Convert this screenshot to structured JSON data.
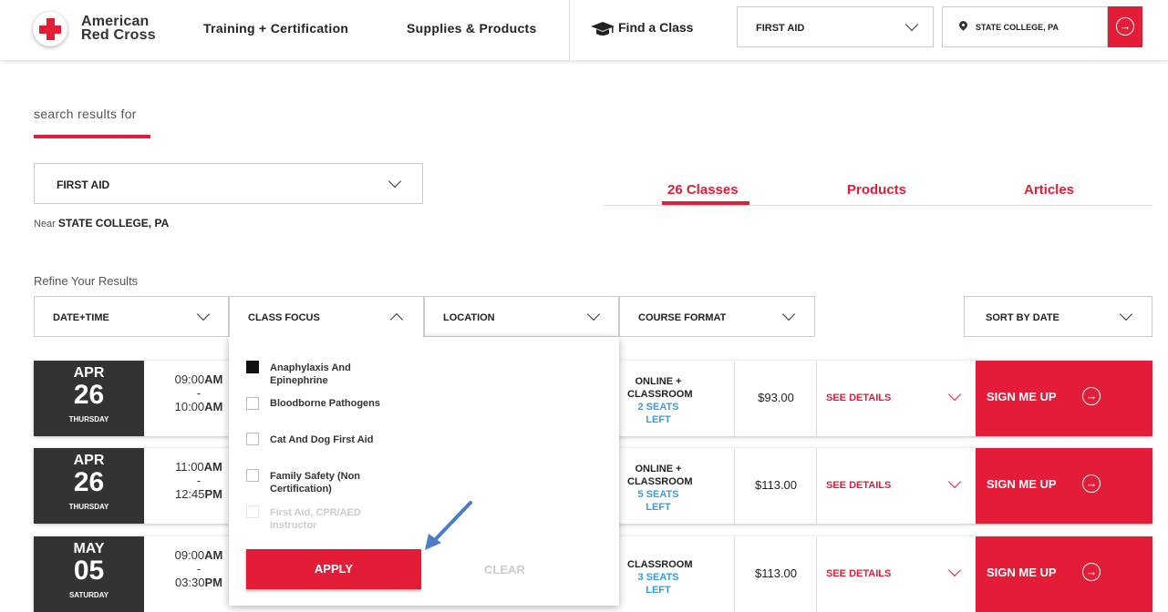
{
  "header": {
    "logo_line1": "American",
    "logo_line2": "Red Cross",
    "nav": [
      "Training + Certification",
      "Supplies & Products"
    ],
    "find_label": "Find a Class",
    "course_select": "FIRST AID",
    "location": "STATE COLLEGE, PA",
    "go_icon": "arrow-right-circle-icon"
  },
  "search": {
    "label": "search results for",
    "course_select": "FIRST AID",
    "near_label": "Near",
    "near_value": "STATE COLLEGE, PA"
  },
  "tabs": [
    "26 Classes",
    "Products",
    "Articles"
  ],
  "refine": {
    "title": "Refine Your Results",
    "filters": [
      "DATE+TIME",
      "CLASS FOCUS",
      "LOCATION",
      "COURSE FORMAT"
    ],
    "sort": "SORT BY DATE"
  },
  "class_focus": {
    "options": [
      {
        "label": "Anaphylaxis And Epinephrine",
        "checked": true,
        "disabled": false
      },
      {
        "label": "Bloodborne Pathogens",
        "checked": false,
        "disabled": false
      },
      {
        "label": "Cat And Dog First Aid",
        "checked": false,
        "disabled": false
      },
      {
        "label": "Family Safety (Non Certification)",
        "checked": false,
        "disabled": false
      },
      {
        "label": "First Aid, CPR/AED Instructor",
        "checked": false,
        "disabled": true
      }
    ],
    "apply": "APPLY",
    "clear": "CLEAR"
  },
  "classes": [
    {
      "month": "APR",
      "day": "26",
      "weekday": "THURSDAY",
      "start_time": "09:00",
      "start_ampm": "AM",
      "dash": "-",
      "end_time": "10:00",
      "end_ampm": "AM",
      "format_line1": "ONLINE +",
      "format_line2": "CLASSROOM",
      "seats": "2 SEATS LEFT",
      "price": "$93.00",
      "details": "SEE DETAILS",
      "signup": "SIGN ME UP"
    },
    {
      "month": "APR",
      "day": "26",
      "weekday": "THURSDAY",
      "start_time": "11:00",
      "start_ampm": "AM",
      "dash": "-",
      "end_time": "12:45",
      "end_ampm": "PM",
      "format_line1": "ONLINE +",
      "format_line2": "CLASSROOM",
      "seats": "5 SEATS LEFT",
      "price": "$113.00",
      "details": "SEE DETAILS",
      "signup": "SIGN ME UP"
    },
    {
      "month": "MAY",
      "day": "05",
      "weekday": "SATURDAY",
      "start_time": "09:00",
      "start_ampm": "AM",
      "dash": "-",
      "end_time": "03:30",
      "end_ampm": "PM",
      "format_line1": "",
      "format_line2": "CLASSROOM",
      "seats": "3 SEATS LEFT",
      "price": "$113.00",
      "details": "SEE DETAILS",
      "signup": "SIGN ME UP"
    }
  ],
  "colors": {
    "brand_red": "#e31c37",
    "date_bg": "#333333",
    "seats_blue": "#3a9bd8",
    "annotation_arrow": "#4a7ec7"
  }
}
